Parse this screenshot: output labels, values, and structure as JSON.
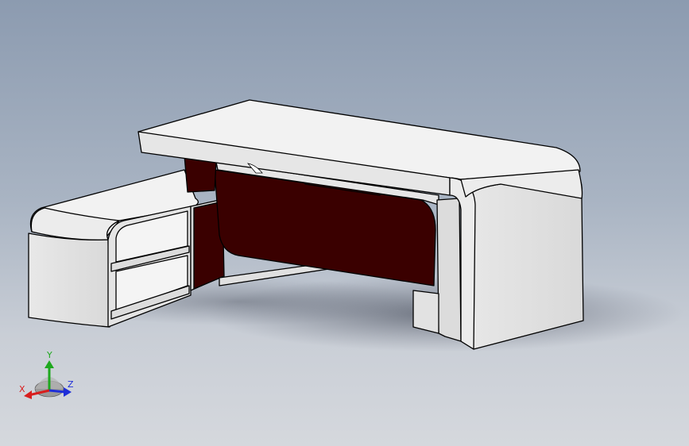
{
  "viewport": {
    "colors": {
      "body": "#f0f0f0",
      "body_shade": "#dcdcdc",
      "panel": "#3a0000",
      "edge": "#000000",
      "x_axis": "#d81e1e",
      "y_axis": "#1ea81e",
      "z_axis": "#1e2ed8"
    }
  },
  "triad": {
    "x_label": "X",
    "y_label": "Y",
    "z_label": "Z"
  }
}
